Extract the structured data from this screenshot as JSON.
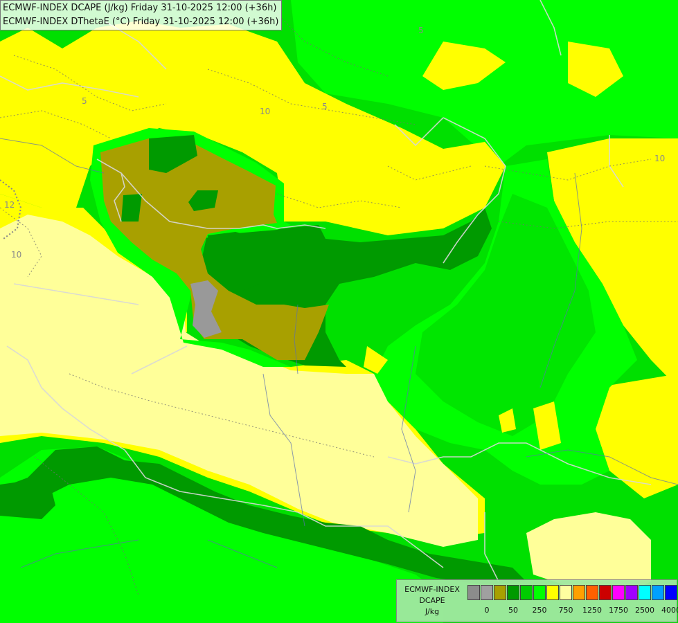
{
  "title": {
    "line1": "ECMWF-INDEX DCAPE (J/kg) Friday 31-10-2025 12:00 (+36h)",
    "line2": "ECMWF-INDEX DThetaE (°C) Friday 31-10-2025 12:00 (+36h)"
  },
  "legend": {
    "model": "ECMWF-INDEX",
    "field": "DCAPE",
    "unit": "J/kg",
    "colors": [
      "#8c8c8c",
      "#a0a0a0",
      "#a8a000",
      "#009a00",
      "#00cc00",
      "#00ff00",
      "#ffff00",
      "#ffffa0",
      "#ffa000",
      "#ff6000",
      "#cc0000",
      "#ff00ff",
      "#a000ff",
      "#00ffff",
      "#00a0ff",
      "#0000ff",
      "#000080"
    ],
    "tick_labels": [
      "0",
      "50",
      "250",
      "750",
      "1250",
      "1750",
      "2500",
      "4000"
    ]
  },
  "contour_labels": [
    "5",
    "5",
    "5",
    "10",
    "10",
    "10",
    "12"
  ],
  "map_colors": {
    "yellow": "#ffff00",
    "pale_yellow": "#ffff99",
    "bright_green": "#00ff00",
    "mid_green": "#00c800",
    "dark_green": "#009a00",
    "olive": "#a8a000",
    "gray": "#999999"
  }
}
